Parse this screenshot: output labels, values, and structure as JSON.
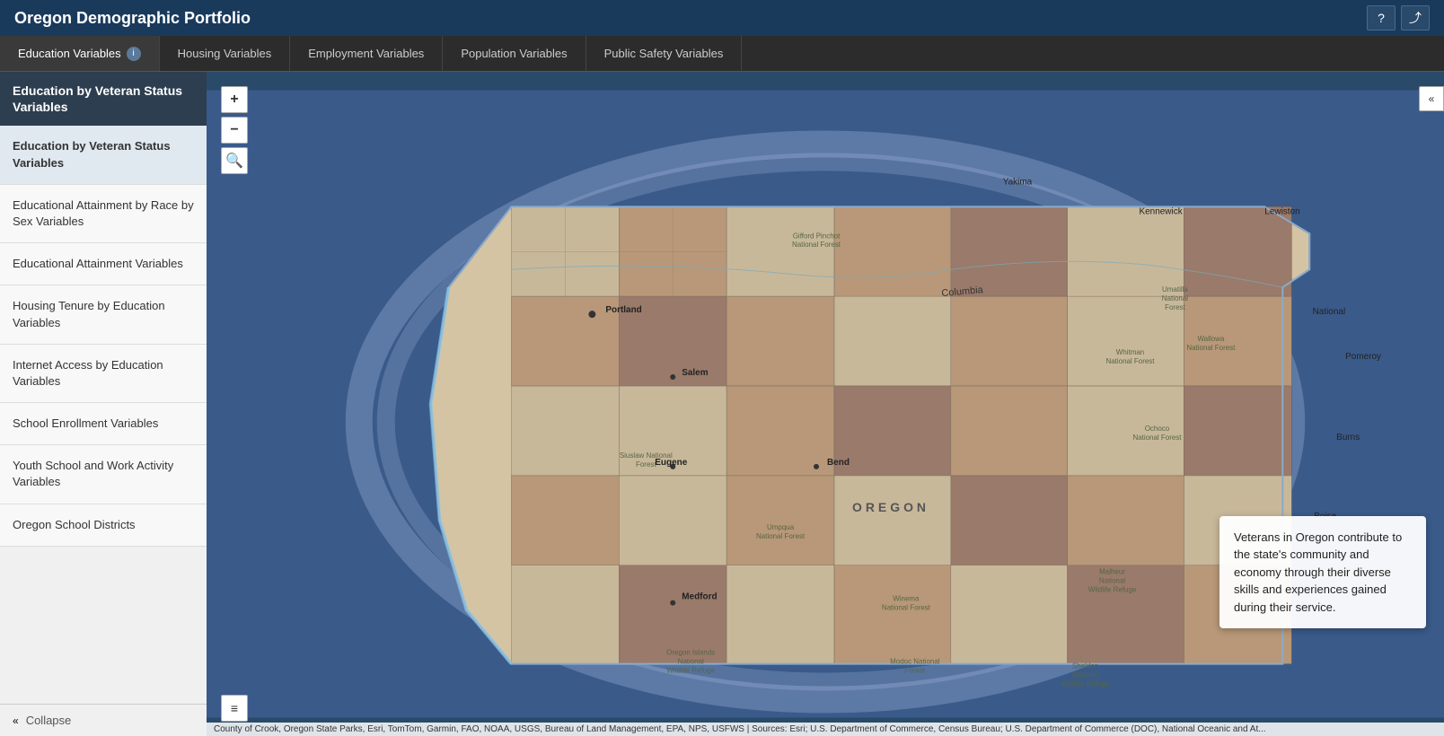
{
  "header": {
    "title": "Oregon Demographic Portfolio",
    "help_label": "?",
    "share_label": "⤴"
  },
  "tabbar": {
    "tabs": [
      {
        "id": "education",
        "label": "Education Variables",
        "active": true,
        "has_info": true
      },
      {
        "id": "housing",
        "label": "Housing Variables",
        "active": false
      },
      {
        "id": "employment",
        "label": "Employment Variables",
        "active": false
      },
      {
        "id": "population",
        "label": "Population Variables",
        "active": false
      },
      {
        "id": "safety",
        "label": "Public Safety Variables",
        "active": false
      }
    ]
  },
  "sidebar": {
    "header": "Education by Veteran Status Variables",
    "items": [
      {
        "id": "veteran",
        "label": "Education by Veteran Status Variables",
        "active": true
      },
      {
        "id": "race-sex",
        "label": "Educational Attainment by Race by Sex Variables",
        "active": false
      },
      {
        "id": "attainment",
        "label": "Educational Attainment Variables",
        "active": false
      },
      {
        "id": "housing-edu",
        "label": "Housing Tenure by Education Variables",
        "active": false
      },
      {
        "id": "internet",
        "label": "Internet Access by Education Variables",
        "active": false
      },
      {
        "id": "enrollment",
        "label": "School Enrollment Variables",
        "active": false
      },
      {
        "id": "youth",
        "label": "Youth School and Work Activity Variables",
        "active": false
      },
      {
        "id": "districts",
        "label": "Oregon School Districts",
        "active": false
      }
    ],
    "collapse_label": "Collapse"
  },
  "map": {
    "zoom_in": "+",
    "zoom_out": "−",
    "search": "🔍",
    "collapse_right": "«",
    "legend": "≡",
    "tooltip": "Veterans in Oregon contribute to the state's community and economy through their diverse skills and experiences gained during their service.",
    "attribution": "County of Crook, Oregon State Parks, Esri, TomTom, Garmin, FAO, NOAA, USGS, Bureau of Land Management, EPA, NPS, USFWS | Sources: Esri; U.S. Department of Commerce, Census Bureau; U.S. Department of Commerce (DOC), National Oceanic and At..."
  }
}
